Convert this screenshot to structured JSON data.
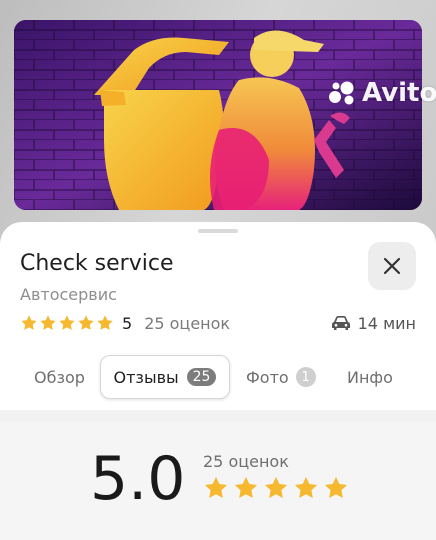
{
  "banner": {
    "image": "auto-mechanic-neon-artwork"
  },
  "place": {
    "name": "Check service",
    "category": "Автосервис",
    "rating": "5",
    "rating_count": "25 оценок",
    "stars": 5,
    "drive_time": "14 мин",
    "drive_icon": "car-icon"
  },
  "tabs": [
    {
      "label": "Обзор"
    },
    {
      "label": "Отзывы",
      "badge": "25",
      "active": true
    },
    {
      "label": "Фото",
      "badge": "1"
    },
    {
      "label": "Инфо"
    }
  ],
  "summary": {
    "score": "5.0",
    "count": "25 оценок",
    "stars": 5
  },
  "watermark": {
    "text": "Avito"
  },
  "colors": {
    "star": "#f5b82e",
    "accent": "#1f1f1f",
    "sheet": "#ffffff"
  }
}
